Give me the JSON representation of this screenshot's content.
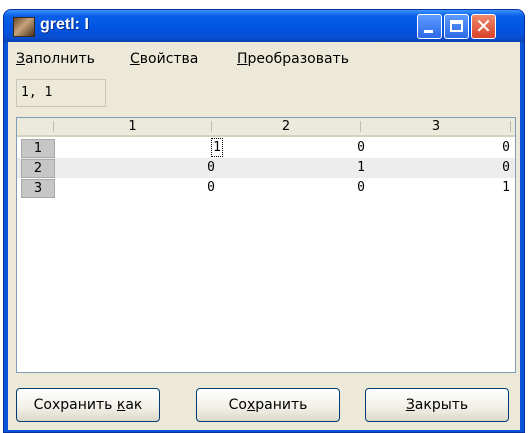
{
  "window": {
    "title": "gretl: I",
    "icon": "gretl-app-icon"
  },
  "menu": {
    "items": [
      {
        "pre": "",
        "mnemonic": "З",
        "post": "аполнить"
      },
      {
        "pre": "",
        "mnemonic": "С",
        "post": "войства"
      },
      {
        "pre": "",
        "mnemonic": "П",
        "post": "реобразовать"
      }
    ]
  },
  "position_field": "1, 1",
  "grid": {
    "column_headers": [
      "1",
      "2",
      "3"
    ],
    "rows": [
      {
        "label": "1",
        "cells": [
          "1",
          "0",
          "0"
        ]
      },
      {
        "label": "2",
        "cells": [
          "0",
          "1",
          "0"
        ]
      },
      {
        "label": "3",
        "cells": [
          "0",
          "0",
          "1"
        ]
      }
    ],
    "focused_cell": "1,1"
  },
  "buttons": {
    "save_as": {
      "pre": "Сохранить ",
      "mnemonic": "к",
      "post": "ак"
    },
    "save": {
      "pre": "Со",
      "mnemonic": "х",
      "post": "ранить"
    },
    "close": {
      "pre": "",
      "mnemonic": "З",
      "post": "акрыть"
    }
  }
}
